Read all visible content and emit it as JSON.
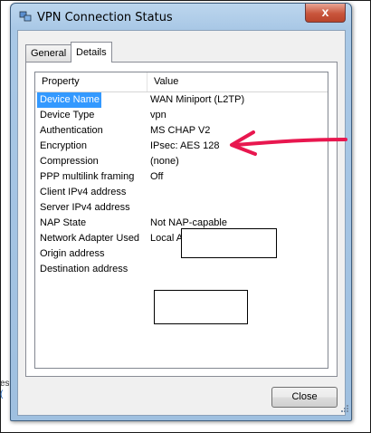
{
  "window": {
    "title": "VPN Connection Status",
    "close_glyph": "x",
    "accent": "#a9c8e6"
  },
  "tabs": [
    {
      "label": "General",
      "selected": false
    },
    {
      "label": "Details",
      "selected": true
    }
  ],
  "details": {
    "columns": {
      "property": "Property",
      "value": "Value"
    },
    "rows": [
      {
        "property": "Device Name",
        "value": "WAN Miniport (L2TP)",
        "selected": true
      },
      {
        "property": "Device Type",
        "value": "vpn"
      },
      {
        "property": "Authentication",
        "value": "MS CHAP V2"
      },
      {
        "property": "Encryption",
        "value": "IPsec: AES 128"
      },
      {
        "property": "Compression",
        "value": "(none)"
      },
      {
        "property": "PPP multilink framing",
        "value": "Off"
      },
      {
        "property": "Client IPv4 address",
        "value": ""
      },
      {
        "property": "Server IPv4 address",
        "value": ""
      },
      {
        "property": "NAP State",
        "value": "Not NAP-capable"
      },
      {
        "property": "Network Adapter Used",
        "value": "Local Area Connection"
      },
      {
        "property": "Origin address",
        "value": ""
      },
      {
        "property": "Destination address",
        "value": ""
      }
    ],
    "selection_color": "#3399ff"
  },
  "annotation": {
    "arrow_color": "#e8174f"
  },
  "buttons": {
    "close_label": "Close"
  },
  "background_fragment": {
    "text": "es"
  }
}
